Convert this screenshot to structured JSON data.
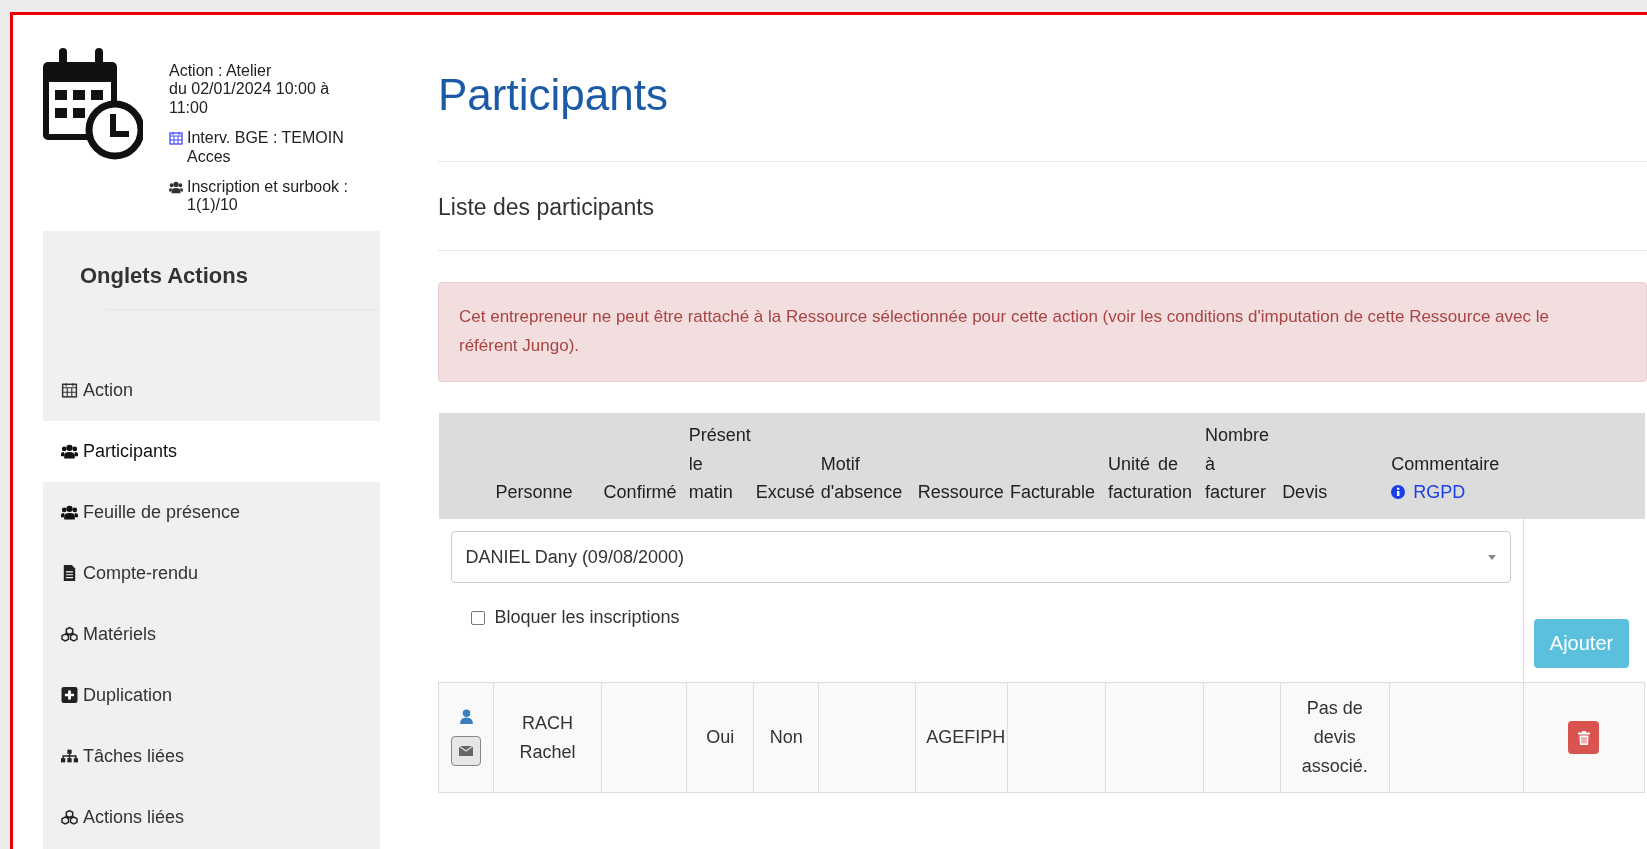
{
  "action_info": {
    "lines": [
      "Action : Atelier",
      "du 02/01/2024 10:00 à 11:00"
    ],
    "intervenant": "Interv. BGE : TEMOIN Acces",
    "inscription": "Inscription et surbook : 1(1)/10"
  },
  "sidebar": {
    "title": "Onglets Actions",
    "items": [
      {
        "label": "Action",
        "kind": "calendar",
        "selected": false
      },
      {
        "label": "Participants",
        "kind": "group",
        "selected": true
      },
      {
        "label": "Feuille de présence",
        "kind": "group",
        "selected": false
      },
      {
        "label": "Compte-rendu",
        "kind": "document",
        "selected": false
      },
      {
        "label": "Matériels",
        "kind": "cubes",
        "selected": false
      },
      {
        "label": "Duplication",
        "kind": "plus",
        "selected": false
      },
      {
        "label": "Tâches liées",
        "kind": "hierarchy",
        "selected": false
      },
      {
        "label": "Actions liées",
        "kind": "cubes",
        "selected": false
      }
    ]
  },
  "page_title": "Participants",
  "section_title": "Liste des participants",
  "alert": "Cet entrepreneur ne peut être rattaché à la Ressource sélectionnée pour cette action (voir les conditions d'imputation de cette Ressource avec le référent Jungo).",
  "table": {
    "columns": [
      "Personne",
      "Confirmé",
      "Présent le matin",
      "Excusé",
      "Motif d'absence",
      "Ressource",
      "Facturable",
      "Unité de facturation",
      "Nombre à facturer",
      "Devis",
      "Commentaire"
    ],
    "rgpd_link": "RGPD",
    "add_form": {
      "select_value": "DANIEL Dany (09/08/2000)",
      "checkbox_label": "Bloquer les inscriptions",
      "checkbox_checked": false,
      "add_button": "Ajouter"
    },
    "rows": [
      {
        "cells": [
          "RACH Rachel",
          "",
          "Oui",
          "Non",
          "",
          "AGEFIPH",
          "",
          "",
          "",
          "Pas de devis associé.",
          ""
        ]
      }
    ]
  }
}
